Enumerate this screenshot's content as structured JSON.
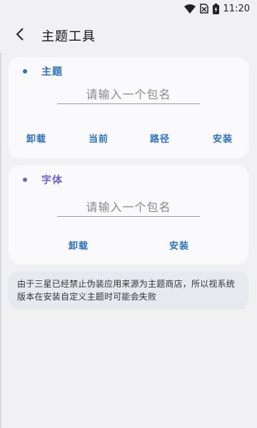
{
  "status_bar": {
    "time": "11:20",
    "icons": [
      "wifi-icon",
      "no-sim-icon",
      "battery-charging-icon"
    ]
  },
  "header": {
    "title": "主题工具",
    "back_icon": "chevron-left-icon"
  },
  "theme_card": {
    "title": "主题",
    "accent": "#2b6fbf",
    "input_placeholder": "请输入一个包名",
    "input_value": "",
    "buttons": [
      "卸载",
      "当前",
      "路径",
      "安装"
    ]
  },
  "font_card": {
    "title": "字体",
    "accent": "#6b63c8",
    "input_placeholder": "请输入一个包名",
    "input_value": "",
    "buttons": [
      "卸载",
      "安装"
    ]
  },
  "notice": {
    "text": "由于三星已经禁止伪装应用来源为主题商店，所以视系统版本在安装自定义主题时可能会失败"
  },
  "colors": {
    "background": "#f1f1f4",
    "card": "#fafafc",
    "notice_bg": "#e6e9f0",
    "button_text": "#2b6fbf"
  }
}
